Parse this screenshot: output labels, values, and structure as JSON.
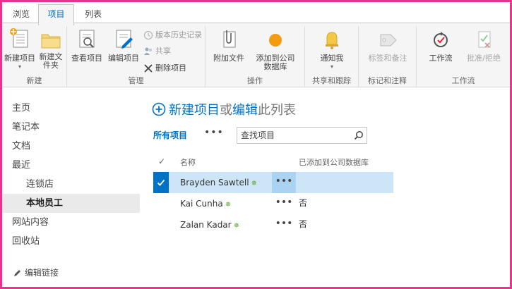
{
  "tabs": {
    "browse": "浏览",
    "items": "项目",
    "list": "列表"
  },
  "ribbon": {
    "new": {
      "label": "新建",
      "new_item": "新建项目",
      "new_folder": "新建文件夹"
    },
    "manage": {
      "label": "管理",
      "view_item": "查看项目",
      "edit_item": "编辑项目",
      "version_history": "版本历史记录",
      "share": "共享",
      "delete_item": "删除项目"
    },
    "actions": {
      "label": "操作",
      "attach_file": "附加文件",
      "add_to_company_db": "添加到公司数据库"
    },
    "share_track": {
      "label": "共享和跟踪",
      "alert_me": "通知我"
    },
    "tags_notes": {
      "label": "标记和注释",
      "tags_and_notes": "标签和备注"
    },
    "workflows": {
      "label": "工作流",
      "workflow": "工作流",
      "approve_reject": "批准/拒绝"
    }
  },
  "left_nav": {
    "items": [
      {
        "label": "主页"
      },
      {
        "label": "笔记本"
      },
      {
        "label": "文档"
      },
      {
        "label": "最近"
      },
      {
        "label": "连锁店"
      },
      {
        "label": "本地员工"
      },
      {
        "label": "网站内容"
      },
      {
        "label": "回收站"
      }
    ],
    "edit_links": "编辑链接"
  },
  "main": {
    "new_item_link": "新建项目",
    "or_text": "或",
    "edit_link": "编辑",
    "this_list": "此列表",
    "view_all": "所有项目",
    "view_more": "•••",
    "search_placeholder": "查找项目",
    "columns": {
      "check": "✓",
      "name": "名称",
      "added_to_db": "已添加到公司数据库"
    },
    "rows": [
      {
        "name": "Brayden Sawtell",
        "menu": "•••",
        "added": ""
      },
      {
        "name": "Kai Cunha",
        "menu": "•••",
        "added": "否"
      },
      {
        "name": "Zalan Kadar",
        "menu": "•••",
        "added": "否"
      }
    ]
  },
  "colors": {
    "accent": "#0072c6",
    "frame": "#e8348f",
    "selected_row": "#cde6f7",
    "new_icon": "#5aa02c",
    "orange": "#f39c12"
  }
}
